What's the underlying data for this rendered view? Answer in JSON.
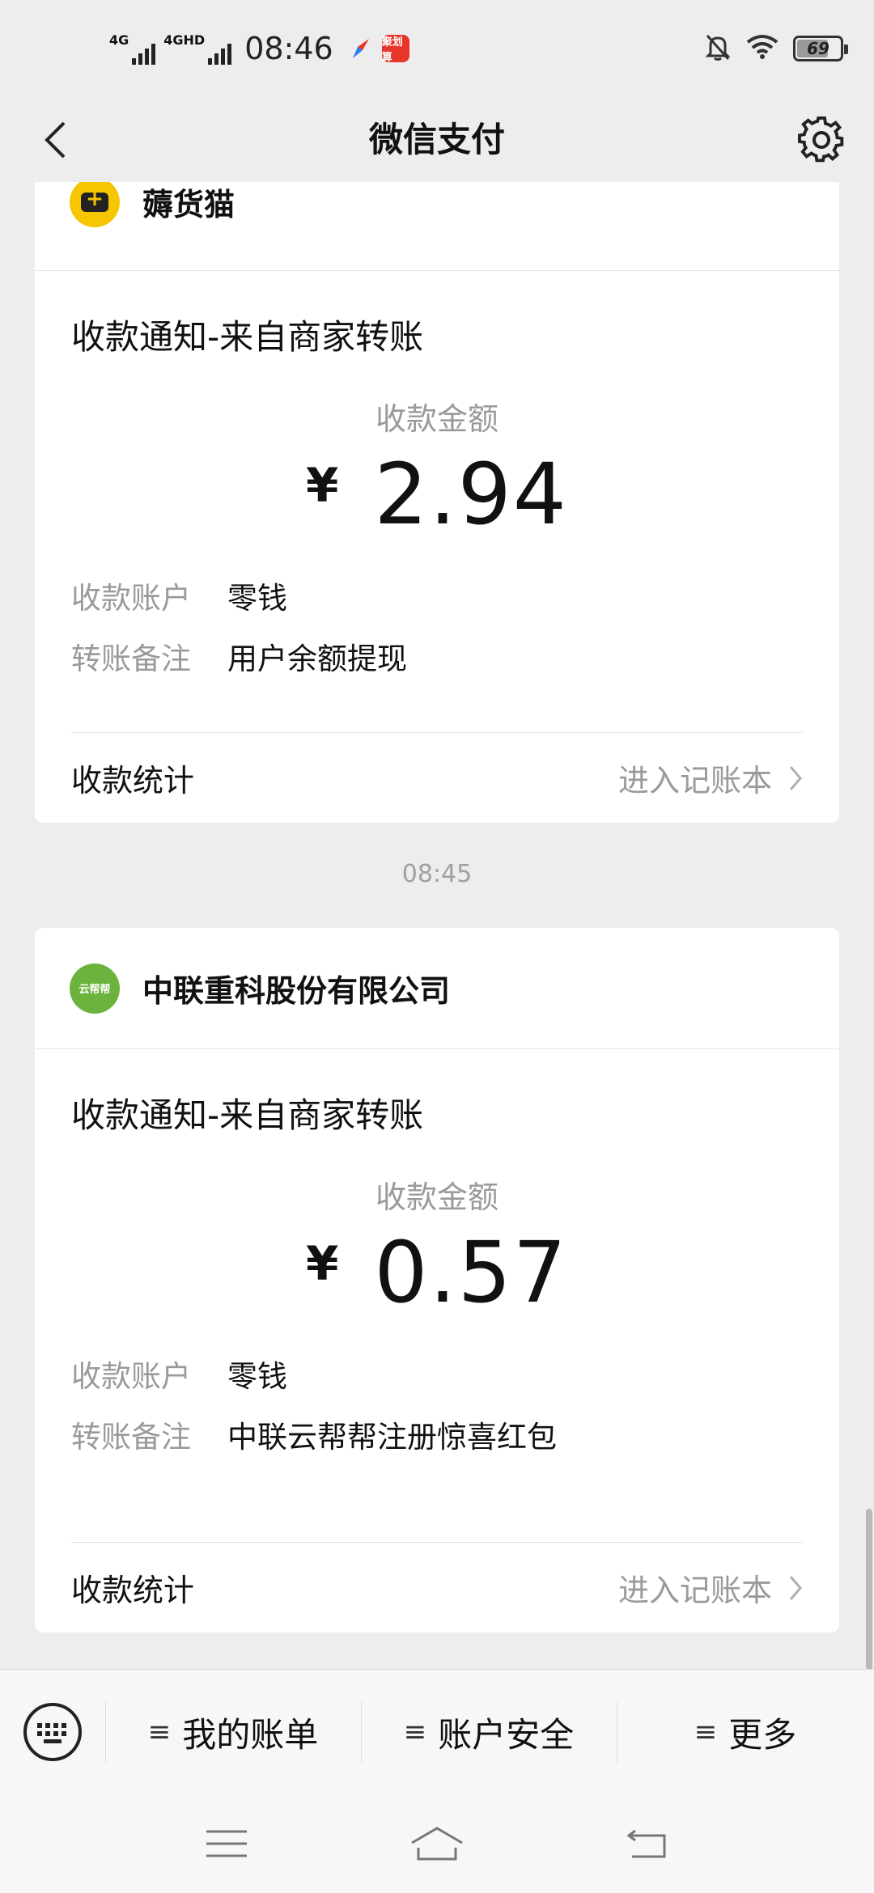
{
  "status_bar": {
    "net1": "4G",
    "net2": "4GHD",
    "time": "08:46",
    "app_badge": "聚划算",
    "battery": "69"
  },
  "header": {
    "title": "微信支付"
  },
  "cards": [
    {
      "merchant": "薅货猫",
      "notice_title": "收款通知-来自商家转账",
      "amount_label": "收款金额",
      "currency": "¥",
      "amount": "2.94",
      "account_label": "收款账户",
      "account_value": "零钱",
      "remark_label": "转账备注",
      "remark_value": "用户余额提现",
      "stats_label": "收款统计",
      "stats_link": "进入记账本"
    },
    {
      "merchant": "中联重科股份有限公司",
      "logo_text": "云帮帮",
      "notice_title": "收款通知-来自商家转账",
      "amount_label": "收款金额",
      "currency": "¥",
      "amount": "0.57",
      "account_label": "收款账户",
      "account_value": "零钱",
      "remark_label": "转账备注",
      "remark_value": "中联云帮帮注册惊喜红包",
      "stats_label": "收款统计",
      "stats_link": "进入记账本"
    }
  ],
  "timestamp": "08:45",
  "menu": {
    "hamburger": "≡",
    "item1": "我的账单",
    "item2": "账户安全",
    "item3": "更多"
  }
}
